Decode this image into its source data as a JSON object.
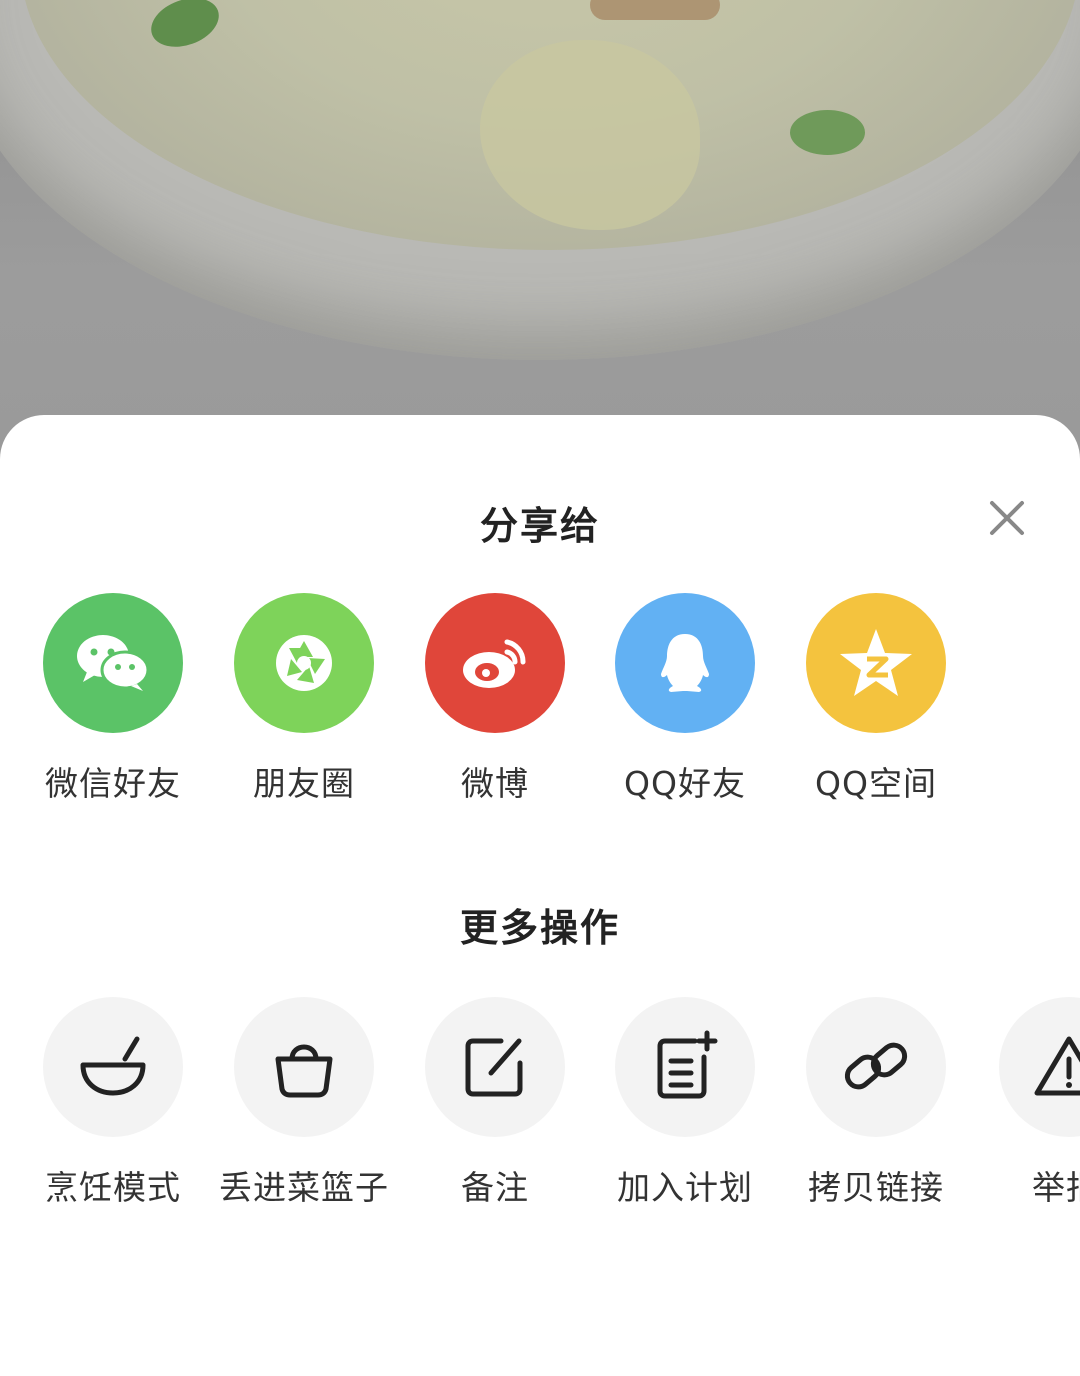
{
  "sheet": {
    "title": "分享给",
    "close_icon": "close-icon"
  },
  "share": {
    "items": [
      {
        "label": "微信好友",
        "icon": "wechat-icon",
        "color": "#5bc367"
      },
      {
        "label": "朋友圈",
        "icon": "moments-icon",
        "color": "#7ed35a"
      },
      {
        "label": "微博",
        "icon": "weibo-icon",
        "color": "#e0463a"
      },
      {
        "label": "QQ好友",
        "icon": "qq-icon",
        "color": "#62b1f3"
      },
      {
        "label": "QQ空间",
        "icon": "qzone-icon",
        "color": "#f4c33e"
      }
    ]
  },
  "more": {
    "title": "更多操作",
    "items": [
      {
        "label": "烹饪模式",
        "icon": "bowl-icon"
      },
      {
        "label": "丢进菜篮子",
        "icon": "basket-icon"
      },
      {
        "label": "备注",
        "icon": "edit-note-icon"
      },
      {
        "label": "加入计划",
        "icon": "add-plan-icon"
      },
      {
        "label": "拷贝链接",
        "icon": "link-icon"
      },
      {
        "label": "举报",
        "icon": "warning-icon"
      }
    ]
  }
}
